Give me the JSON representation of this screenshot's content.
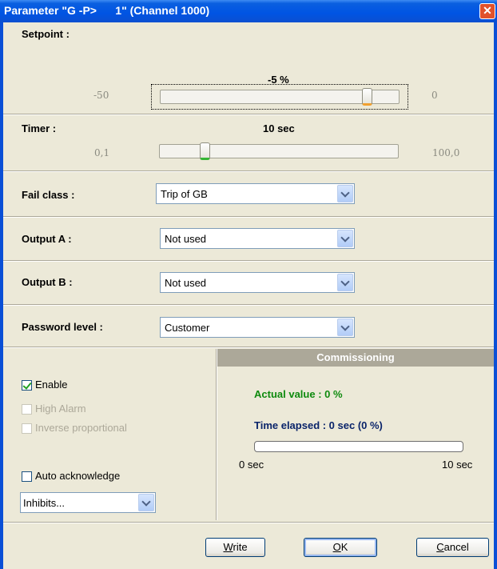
{
  "window": {
    "title": "Parameter \"G -P>      1\" (Channel 1000)",
    "close_glyph": "✕"
  },
  "setpoint": {
    "label": "Setpoint :",
    "value_text": "-5 %",
    "min": "-50",
    "max": "0",
    "value": -5,
    "range": [
      -50,
      0
    ]
  },
  "timer": {
    "label": "Timer :",
    "value_text": "10 sec",
    "min": "0,1",
    "max": "100,0",
    "value": 10,
    "range": [
      0.1,
      100
    ]
  },
  "fail_class": {
    "label": "Fail class :",
    "value": "Trip of GB"
  },
  "output_a": {
    "label": "Output A :",
    "value": "Not used"
  },
  "output_b": {
    "label": "Output B :",
    "value": "Not used"
  },
  "password_level": {
    "label": "Password level :",
    "value": "Customer"
  },
  "options": {
    "enable": {
      "label": "Enable",
      "checked": true
    },
    "high_alarm": {
      "label": "High Alarm",
      "checked": false,
      "disabled": true
    },
    "inverse": {
      "label": "Inverse proportional",
      "checked": false,
      "disabled": true
    },
    "auto_ack": {
      "label": "Auto acknowledge",
      "checked": false
    },
    "inhibits": {
      "value": "Inhibits..."
    }
  },
  "commissioning": {
    "header": "Commissioning",
    "actual_value": "Actual value : 0 %",
    "time_elapsed": "Time elapsed : 0 sec (0 %)",
    "progress": 0,
    "progress_min": "0 sec",
    "progress_max": "10 sec"
  },
  "buttons": {
    "write": {
      "mnemonic": "W",
      "rest": "rite"
    },
    "ok": {
      "mnemonic": "O",
      "rest": "K"
    },
    "cancel": {
      "mnemonic": "C",
      "rest": "ancel"
    }
  },
  "colors": {
    "titlebar": "#0054e3",
    "green_text": "#0e8a0e",
    "navy_text": "#0a246a",
    "commissioning_bg": "#aca899"
  }
}
